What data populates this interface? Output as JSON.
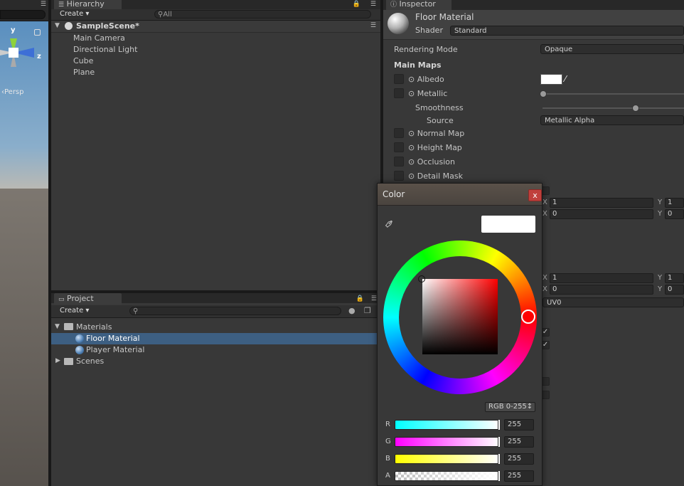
{
  "scene": {
    "gizmo_y": "y",
    "gizmo_z": "z",
    "persp_label": "‹Persp"
  },
  "hierarchy": {
    "tab": "Hierarchy",
    "create": "Create ▾",
    "search_placeholder": "All",
    "scene_name": "SampleScene*",
    "items": [
      "Main Camera",
      "Directional Light",
      "Cube",
      "Plane"
    ]
  },
  "project": {
    "tab": "Project",
    "create": "Create ▾",
    "tree": [
      {
        "label": "Materials",
        "type": "folder"
      },
      {
        "label": "Floor Material",
        "type": "material",
        "selected": true
      },
      {
        "label": "Player Material",
        "type": "material"
      },
      {
        "label": "Scenes",
        "type": "folder"
      }
    ]
  },
  "inspector": {
    "tab": "Inspector",
    "material_name": "Floor Material",
    "shader_label": "Shader",
    "shader_value": "Standard",
    "rendering_mode_label": "Rendering Mode",
    "rendering_mode_value": "Opaque",
    "main_maps_label": "Main Maps",
    "albedo": "Albedo",
    "metallic": "Metallic",
    "smoothness": "Smoothness",
    "source": "Source",
    "source_value": "Metallic Alpha",
    "normal_map": "Normal Map",
    "height_map": "Height Map",
    "occlusion": "Occlusion",
    "detail_mask": "Detail Mask",
    "tiling_x1": "1",
    "tiling_y1": "1",
    "offset_x1": "0",
    "offset_y1": "0",
    "tiling_x2": "1",
    "tiling_y2": "1",
    "offset_x2": "0",
    "offset_y2": "0",
    "uv_set": "UV0",
    "axis_x": "X",
    "axis_y": "Y"
  },
  "picker": {
    "title": "Color",
    "close": "x",
    "mode": "RGB 0-255↕",
    "swatch_color": "#ffffff",
    "channels": [
      {
        "label": "R",
        "value": "255"
      },
      {
        "label": "G",
        "value": "255"
      },
      {
        "label": "B",
        "value": "255"
      },
      {
        "label": "A",
        "value": "255"
      }
    ]
  }
}
